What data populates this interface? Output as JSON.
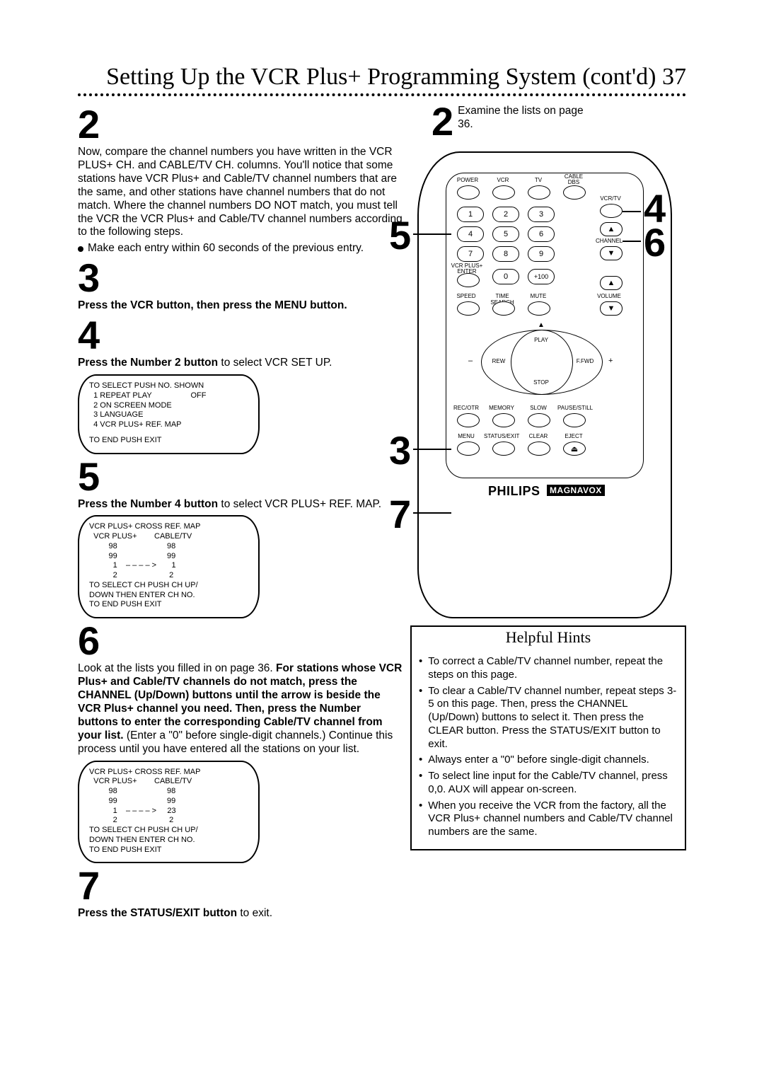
{
  "title": "Setting Up the VCR Plus+ Programming System (cont'd) 37",
  "examine": {
    "num": "2",
    "text": "Examine the lists on page 36."
  },
  "step2": {
    "num": "2",
    "para": "Now, compare the channel numbers you have written in the VCR PLUS+ CH. and CABLE/TV CH. columns. You'll notice that some stations have VCR Plus+ and Cable/TV channel numbers that are the same, and other stations have channel numbers that do not match. Where the channel numbers DO NOT match, you must tell the VCR the VCR Plus+ and Cable/TV channel numbers according to the following steps.",
    "bullet": "Make each entry within 60 seconds of the previous entry."
  },
  "step3": {
    "num": "3",
    "line": "Press the VCR button, then press the MENU button."
  },
  "step4": {
    "num": "4",
    "line_b": "Press the Number 2 button",
    "line_r": " to select VCR SET UP."
  },
  "osd1": {
    "l1": "TO SELECT PUSH NO. SHOWN",
    "l2": "  1 REPEAT PLAY                  OFF",
    "l3": "  2 ON SCREEN MODE",
    "l4": "  3 LANGUAGE",
    "l5": "  4 VCR PLUS+ REF. MAP",
    "l6": "TO END PUSH EXIT"
  },
  "step5": {
    "num": "5",
    "line_b": "Press the Number 4 button",
    "line_r": " to select VCR PLUS+ REF. MAP."
  },
  "osd2": {
    "l1": "VCR PLUS+ CROSS REF. MAP",
    "l2": "  VCR PLUS+        CABLE/TV",
    "l3": "         98                       98",
    "l4": "         99                       99",
    "l5": "           1    – – – – >       1",
    "l6": "           2                        2",
    "l7": "TO SELECT CH PUSH CH UP/",
    "l8": "DOWN THEN ENTER CH NO.",
    "l9": "TO END PUSH EXIT"
  },
  "step6": {
    "num": "6",
    "pre": "Look at the lists you filled in on page 36. ",
    "bold": "For stations whose VCR Plus+ and Cable/TV channels do not match, press the CHANNEL (Up/Down) buttons until the arrow is beside the VCR Plus+ channel you need. Then, press the Number buttons to enter the corresponding Cable/TV channel from your list.",
    "post": " (Enter a \"0\" before single-digit channels.) Continue this process until you have entered all the stations on your list."
  },
  "osd3": {
    "l1": "VCR PLUS+ CROSS REF. MAP",
    "l2": "  VCR PLUS+        CABLE/TV",
    "l3": "         98                       98",
    "l4": "         99                       99",
    "l5": "           1    – – – – >     23",
    "l6": "           2                        2",
    "l7": "TO SELECT CH PUSH CH UP/",
    "l8": "DOWN THEN ENTER CH NO.",
    "l9": "TO END PUSH EXIT"
  },
  "step7": {
    "num": "7",
    "line_b": "Press the STATUS/EXIT button",
    "line_r": " to exit."
  },
  "hints": {
    "title": "Helpful Hints",
    "items": [
      "To correct a Cable/TV channel number, repeat the steps on this page.",
      "To clear a Cable/TV channel number, repeat steps 3-5 on this page. Then, press the CHANNEL (Up/Down) buttons to select it. Then press the CLEAR button.  Press the STATUS/EXIT button to exit.",
      "Always enter a \"0\" before single-digit channels.",
      "To select line input for the Cable/TV channel, press 0,0. AUX will appear on-screen.",
      "When you receive the VCR from the factory, all the VCR Plus+ channel numbers and Cable/TV channel numbers are the same."
    ],
    "bullets": [
      "•",
      "•",
      "•",
      "•",
      "•"
    ]
  },
  "remote": {
    "labels": {
      "power": "POWER",
      "vcr": "VCR",
      "tv": "TV",
      "dbs": "CABLE DBS",
      "vcrtv": "VCR/TV",
      "vcrplus": "VCR PLUS+ ENTER",
      "p100": "+100",
      "channel": "CHANNEL",
      "speed": "SPEED",
      "timesearch": "TIME SEARCH",
      "mute": "MUTE",
      "volume": "VOLUME",
      "play": "PLAY",
      "rew": "REW",
      "ffwd": "F.FWD",
      "stop": "STOP",
      "recotr": "REC/OTR",
      "memory": "MEMORY",
      "slow": "SLOW",
      "pause": "PAUSE/STILL",
      "menu": "MENU",
      "status": "STATUS/EXIT",
      "clear": "CLEAR",
      "eject": "EJECT"
    },
    "nums": {
      "1": "1",
      "2": "2",
      "3": "3",
      "4": "4",
      "5": "5",
      "6": "6",
      "7": "7",
      "8": "8",
      "9": "9",
      "0": "0"
    },
    "brand": "PHILIPS",
    "brandbox": "MAGNAVOX",
    "minus": "–",
    "plus": "+",
    "callouts": {
      "c3": "3",
      "c4": "4",
      "c5": "5",
      "c6": "6",
      "c7": "7"
    }
  }
}
